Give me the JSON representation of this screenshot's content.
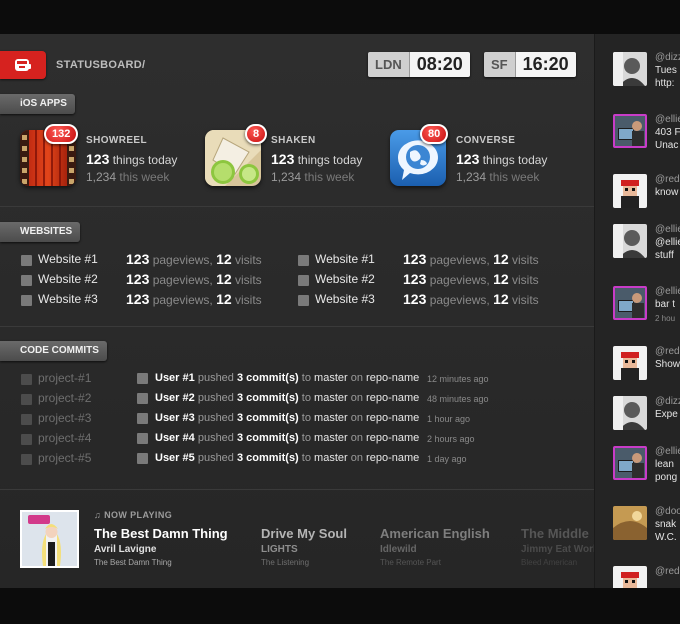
{
  "header": {
    "brand": "STATUSBOARD/",
    "clocks": [
      {
        "city": "LDN",
        "time": "08:20"
      },
      {
        "city": "SF",
        "time": "16:20"
      }
    ]
  },
  "sections": {
    "apps": "iOS APPS",
    "websites": "WEBSITES",
    "commits": "CODE COMMITS"
  },
  "apps": [
    {
      "name": "SHOWREEL",
      "badge": "132",
      "today_num": "123",
      "today_text": "things today",
      "week_num": "1,234",
      "week_text": "this week",
      "icon": "film-icon"
    },
    {
      "name": "SHAKEN",
      "badge": "8",
      "today_num": "123",
      "today_text": "things today",
      "week_num": "1,234",
      "week_text": "this week",
      "icon": "cocktail-icon"
    },
    {
      "name": "CONVERSE",
      "badge": "80",
      "today_num": "123",
      "today_text": "things today",
      "week_num": "1,234",
      "week_text": "this week",
      "icon": "globe-chat-icon"
    }
  ],
  "websites": {
    "pageviews_label": "pageviews,",
    "visits_label": "visits",
    "rows": [
      {
        "name": "Website #1",
        "pageviews": "123",
        "visits": "12"
      },
      {
        "name": "Website #2",
        "pageviews": "123",
        "visits": "12"
      },
      {
        "name": "Website #3",
        "pageviews": "123",
        "visits": "12"
      },
      {
        "name": "Website #1",
        "pageviews": "123",
        "visits": "12"
      },
      {
        "name": "Website #2",
        "pageviews": "123",
        "visits": "12"
      },
      {
        "name": "Website #3",
        "pageviews": "123",
        "visits": "12"
      }
    ]
  },
  "projects": [
    "project-#1",
    "project-#2",
    "project-#3",
    "project-#4",
    "project-#5"
  ],
  "commits": {
    "pushed": "pushed",
    "to": "to",
    "on": "on",
    "rows": [
      {
        "user": "User #1",
        "count": "3 commit(s)",
        "branch": "master",
        "repo": "repo-name",
        "ago": "12 minutes ago"
      },
      {
        "user": "User #2",
        "count": "3 commit(s)",
        "branch": "master",
        "repo": "repo-name",
        "ago": "48 minutes ago"
      },
      {
        "user": "User #3",
        "count": "3 commit(s)",
        "branch": "master",
        "repo": "repo-name",
        "ago": "1 hour ago"
      },
      {
        "user": "User #4",
        "count": "3 commit(s)",
        "branch": "master",
        "repo": "repo-name",
        "ago": "2 hours ago"
      },
      {
        "user": "User #5",
        "count": "3 commit(s)",
        "branch": "master",
        "repo": "repo-name",
        "ago": "1 day ago"
      }
    ]
  },
  "now_playing": {
    "label": "NOW PLAYING",
    "tracks": [
      {
        "title": "The Best Damn Thing",
        "artist": "Avril Lavigne",
        "album": "The Best Damn Thing"
      },
      {
        "title": "Drive My Soul",
        "artist": "LIGHTS",
        "album": "The Listening"
      },
      {
        "title": "American English",
        "artist": "Idlewild",
        "album": "The Remote Part"
      },
      {
        "title": "The Middle",
        "artist": "Jimmy Eat World",
        "album": "Bleed American"
      }
    ]
  },
  "tweets": [
    {
      "user": "@dizz",
      "lines": [
        "Tues",
        "http:"
      ],
      "avatar": "bw"
    },
    {
      "user": "@ellie",
      "lines": [
        "403 F",
        "Unac"
      ],
      "avatar": "mac"
    },
    {
      "user": "@red",
      "lines": [
        "know"
      ],
      "avatar": "8bit"
    },
    {
      "user": "@ellie",
      "lines": [
        "@ellie",
        "stuff"
      ],
      "avatar": "bw"
    },
    {
      "user": "@ellie",
      "lines": [
        "bar t"
      ],
      "small": "2 hou",
      "avatar": "mac"
    },
    {
      "user": "@red",
      "lines": [
        "Show"
      ],
      "avatar": "8bit"
    },
    {
      "user": "@dizz",
      "lines": [
        "Expe"
      ],
      "avatar": "bw"
    },
    {
      "user": "@ellie",
      "lines": [
        "lean",
        "pong"
      ],
      "avatar": "mac"
    },
    {
      "user": "@doo",
      "lines": [
        "snak",
        "W.C."
      ],
      "avatar": "sand"
    },
    {
      "user": "@red",
      "lines": [],
      "avatar": "8bit"
    }
  ]
}
